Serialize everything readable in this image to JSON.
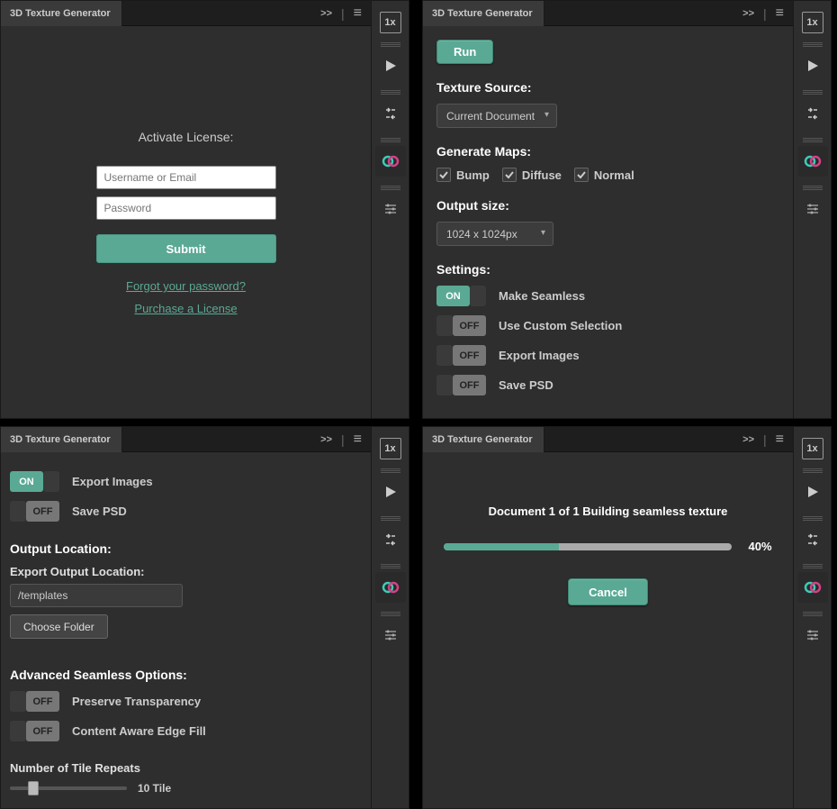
{
  "common": {
    "app_title": "3D Texture Generator",
    "chevrons": ">>",
    "box1x": "1x"
  },
  "panel1": {
    "activate_label": "Activate License:",
    "username_ph": "Username or Email",
    "password_ph": "Password",
    "submit": "Submit",
    "forgot": "Forgot your password?",
    "purchase": "Purchase a License"
  },
  "panel2": {
    "run": "Run",
    "texture_source_h": "Texture Source:",
    "texture_source_sel": "Current Document",
    "generate_maps_h": "Generate Maps:",
    "map_bump": "Bump",
    "map_diffuse": "Diffuse",
    "map_normal": "Normal",
    "output_size_h": "Output size:",
    "output_size_sel": "1024 x 1024px",
    "settings_h": "Settings:",
    "make_seamless": "Make Seamless",
    "use_custom_sel": "Use Custom Selection",
    "export_images": "Export Images",
    "save_psd": "Save PSD",
    "on": "ON",
    "off": "OFF"
  },
  "panel3": {
    "export_images": "Export Images",
    "save_psd": "Save PSD",
    "output_location_h": "Output Location:",
    "export_output_label": "Export Output Location:",
    "output_path": "/templates",
    "choose_folder": "Choose Folder",
    "advanced_h": "Advanced Seamless Options:",
    "preserve_transparency": "Preserve Transparency",
    "content_aware": "Content Aware Edge Fill",
    "num_tile_h": "Number of Tile Repeats",
    "tile_val": "10 Tile",
    "on": "ON",
    "off": "OFF"
  },
  "panel4": {
    "message": "Document 1 of 1 Building seamless texture",
    "percent": "40%",
    "percent_num": 40,
    "cancel": "Cancel"
  }
}
